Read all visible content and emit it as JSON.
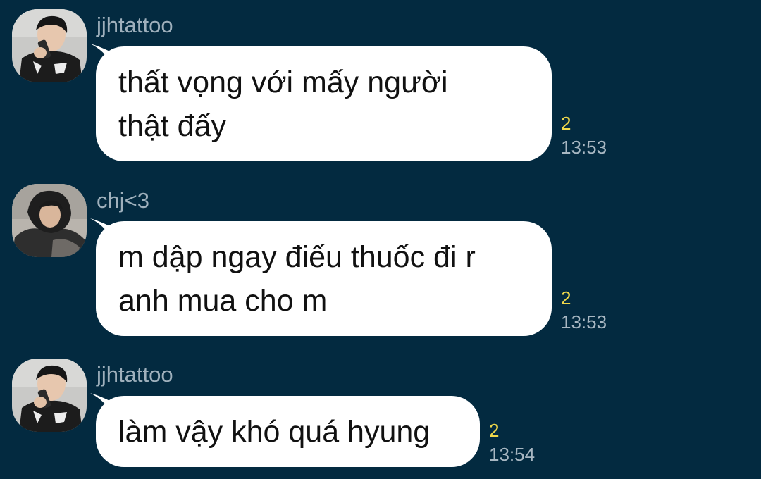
{
  "colors": {
    "background": "#032a40",
    "bubble": "#ffffff",
    "sender_name": "#9fb0bc",
    "read_count": "#f0d84a",
    "timestamp": "#a8b7c2"
  },
  "messages": [
    {
      "sender": "jjhtattoo",
      "avatar_icon": "avatar-jjhtattoo",
      "lines": [
        "thất vọng với mấy người",
        "thật đấy"
      ],
      "read_count": "2",
      "time": "13:53"
    },
    {
      "sender": "chj<3",
      "avatar_icon": "avatar-chj",
      "lines": [
        "m dập ngay điếu thuốc đi r",
        "anh mua cho m"
      ],
      "read_count": "2",
      "time": "13:53"
    },
    {
      "sender": "jjhtattoo",
      "avatar_icon": "avatar-jjhtattoo",
      "lines": [
        "làm vậy khó quá hyung"
      ],
      "read_count": "2",
      "time": "13:54"
    }
  ]
}
